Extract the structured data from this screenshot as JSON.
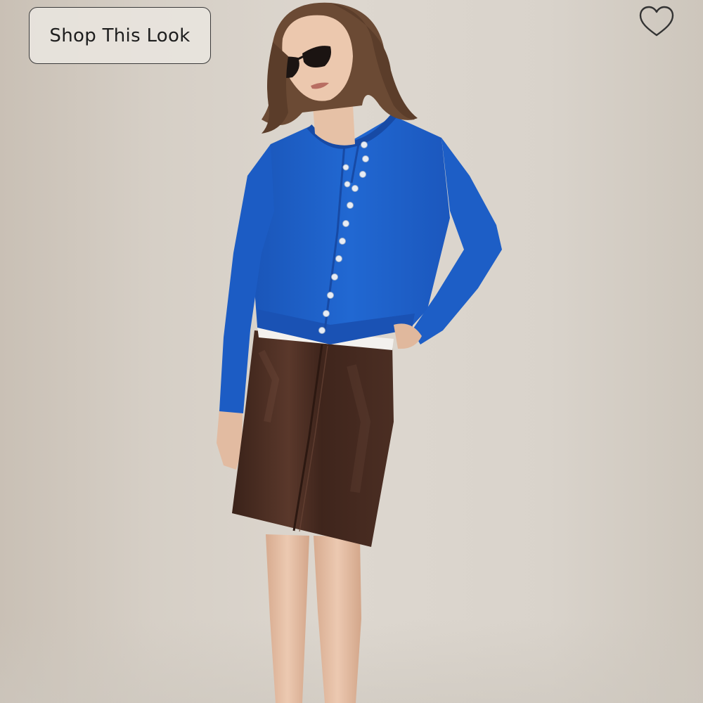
{
  "product_card": {
    "shop_button_label": "Shop This Look",
    "wishlist_icon": "heart-outline-icon"
  },
  "photo": {
    "subject": "model-wearing-outfit",
    "colors": {
      "background": "#d6cfc6",
      "cardigan": "#1f62c9",
      "skirt": "#4a2d23",
      "skin": "#e6c2a8",
      "hair": "#6b4a34"
    }
  }
}
